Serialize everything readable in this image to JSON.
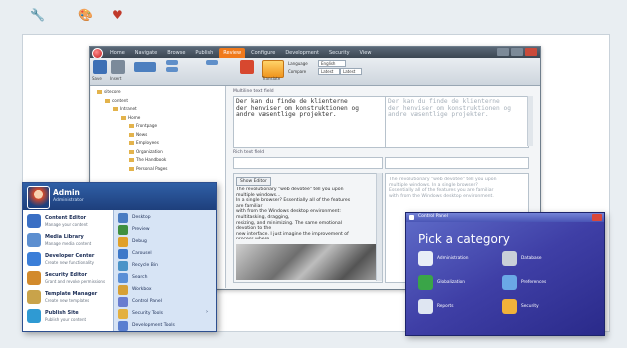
{
  "top_icons": [
    "wrench-icon",
    "paint-icon",
    "heart-icon"
  ],
  "app": {
    "tabs": [
      "Home",
      "Navigate",
      "Browse",
      "Publish",
      "Review",
      "Configure",
      "Development",
      "Security",
      "View"
    ],
    "active_tab": "Review",
    "ribbon": {
      "buttons": [
        {
          "label": "Save",
          "icon": "save-icon"
        },
        {
          "label": "Insert",
          "icon": "insert-icon"
        },
        {
          "label": "Translate",
          "icon": "translate-icon"
        }
      ],
      "options": [
        "Language",
        "Compare"
      ],
      "selects": [
        "English",
        "Latest",
        "Latest"
      ]
    },
    "tree": [
      {
        "label": "sitecore",
        "depth": 0
      },
      {
        "label": "content",
        "depth": 1
      },
      {
        "label": "Intranet",
        "depth": 2
      },
      {
        "label": "Home",
        "depth": 3
      },
      {
        "label": "Frontpage",
        "depth": 4
      },
      {
        "label": "News",
        "depth": 4
      },
      {
        "label": "Employees",
        "depth": 4
      },
      {
        "label": "Organization",
        "depth": 4
      },
      {
        "label": "The Handbook",
        "depth": 4
      },
      {
        "label": "Personal Pages",
        "depth": 4
      }
    ],
    "editor": {
      "section_title": "Multiline text field",
      "source_text": "Der kan du finde de klienterne\nder henviser om konstruktionen og\nandre væsentlige projekter.",
      "target_text": "Der kan du finde de klienterne\nder henviser om konstruktionen og\nandre væsentlige projekter.",
      "field_label": "Rich text field",
      "show_editor": "Show Editor",
      "doc_text": "The revolutionary \"web devotee\" tell you upon\nmultiple windows...\nIn a single browser? Essentially all of the features you\nare familiar\nwith from the Windows desktop environment:\nmultitasking, dragging,\nresizing, and minimizing. The same emotional\ndevotion to the\nnew interface. I just imagine the improvement of\nprocess where\nediters can customize their workspace without\nhaving to deal with\nlimited screen space.",
      "doc_text_right": "The revolutionary \"web devotee\" tell you upon\nmultiple windows. In a single browser?\nEssentially all of the features you are familiar\nwith from the Windows desktop environment."
    }
  },
  "start_menu": {
    "user": "Admin",
    "user_sub": "Administrator",
    "left_items": [
      {
        "name": "Content Editor",
        "desc": "Manage your content",
        "color": "#3a6fc4"
      },
      {
        "name": "Media Library",
        "desc": "Manage media content",
        "color": "#5d8fd0"
      },
      {
        "name": "Developer Center",
        "desc": "Create new functionality",
        "color": "#3b7ed8"
      },
      {
        "name": "Security Editor",
        "desc": "Grant and revoke permissions",
        "color": "#d28a2c"
      },
      {
        "name": "Template Manager",
        "desc": "Create new templates",
        "color": "#c9a34a"
      },
      {
        "name": "Publish Site",
        "desc": "Publish your content",
        "color": "#2f9ad3"
      }
    ],
    "right_items": [
      {
        "name": "Desktop",
        "color": "#4a7cc2"
      },
      {
        "name": "Preview",
        "color": "#3f8f3f"
      },
      {
        "name": "Debug",
        "color": "#e0a02a"
      },
      {
        "name": "Carousel",
        "color": "#3d78c9"
      },
      {
        "name": "Recycle Bin",
        "color": "#4a93c8"
      },
      {
        "name": "Search",
        "color": "#5b8fd6"
      },
      {
        "name": "Workbox",
        "color": "#d7a036"
      },
      {
        "name": "Control Panel",
        "color": "#6a7dd0"
      },
      {
        "name": "Security Tools",
        "color": "#e3b040",
        "arrow": "›"
      },
      {
        "name": "Development Tools",
        "color": "#5a7fd0"
      }
    ]
  },
  "control_panel": {
    "title": "Control Panel",
    "heading": "Pick a category",
    "items": [
      {
        "name": "Administration",
        "color": "#e8eef7"
      },
      {
        "name": "Database",
        "color": "#c9cfd8"
      },
      {
        "name": "Globalization",
        "color": "#3aa548"
      },
      {
        "name": "Preferences",
        "color": "#6aa8e6"
      },
      {
        "name": "Reports",
        "color": "#dfe6f2"
      },
      {
        "name": "Security",
        "color": "#f1b23a"
      }
    ]
  }
}
